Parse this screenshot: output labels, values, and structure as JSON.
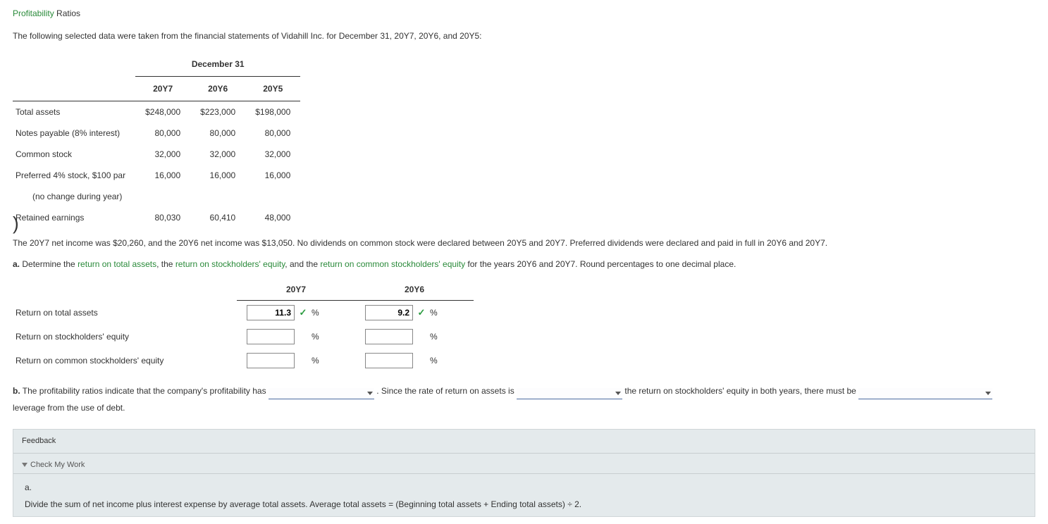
{
  "title_green": "Profitability",
  "title_rest": " Ratios",
  "intro": "The following selected data were taken from the financial statements of Vidahill Inc. for December 31, 20Y7, 20Y6, and 20Y5:",
  "table": {
    "group_header": "December 31",
    "years": [
      "20Y7",
      "20Y6",
      "20Y5"
    ],
    "rows": [
      {
        "label": "Total assets",
        "vals": [
          "$248,000",
          "$223,000",
          "$198,000"
        ]
      },
      {
        "label": "Notes payable (8% interest)",
        "vals": [
          "80,000",
          "80,000",
          "80,000"
        ]
      },
      {
        "label": "Common stock",
        "vals": [
          "32,000",
          "32,000",
          "32,000"
        ]
      },
      {
        "label": "Preferred 4% stock, $100 par",
        "vals": [
          "16,000",
          "16,000",
          "16,000"
        ]
      },
      {
        "label": "(no change during year)",
        "indent": true,
        "vals": [
          "",
          "",
          ""
        ]
      },
      {
        "label": "Retained earnings",
        "vals": [
          "80,030",
          "60,410",
          "48,000"
        ]
      }
    ]
  },
  "para2": "The 20Y7 net income was $20,260, and the 20Y6 net income was $13,050. No dividends on common stock were declared between 20Y5 and 20Y7. Preferred dividends were declared and paid in full in 20Y6 and 20Y7.",
  "qa": {
    "label": "a.",
    "pre": "  Determine the ",
    "link1": "return on total assets",
    "mid1": ", the ",
    "link2": "return on stockholders' equity",
    "mid2": ", and the ",
    "link3": "return on common stockholders' equity",
    "post": " for the years 20Y6 and 20Y7. Round percentages to one decimal place."
  },
  "answers": {
    "years": [
      "20Y7",
      "20Y6"
    ],
    "rows": [
      {
        "label": "Return on total assets",
        "y7": "11.3",
        "y7_ok": true,
        "y6": "9.2",
        "y6_ok": true
      },
      {
        "label": "Return on stockholders' equity",
        "y7": "",
        "y7_ok": false,
        "y6": "",
        "y6_ok": false
      },
      {
        "label": "Return on common stockholders' equity",
        "y7": "",
        "y7_ok": false,
        "y6": "",
        "y6_ok": false
      }
    ],
    "pct": "%"
  },
  "qb": {
    "label": "b.",
    "t1": "  The profitability ratios indicate that the company's profitability has ",
    "t2": " . Since the rate of return on assets is ",
    "t3": " the return on stockholders' equity in both years, there must be ",
    "t4": " leverage from the use of debt."
  },
  "feedback": {
    "head": "Feedback",
    "check": "Check My Work",
    "a_label": "a.",
    "a_text": "Divide the sum of net income plus interest expense by average total assets. Average total assets = (Beginning total assets + Ending total assets) ÷ 2."
  }
}
